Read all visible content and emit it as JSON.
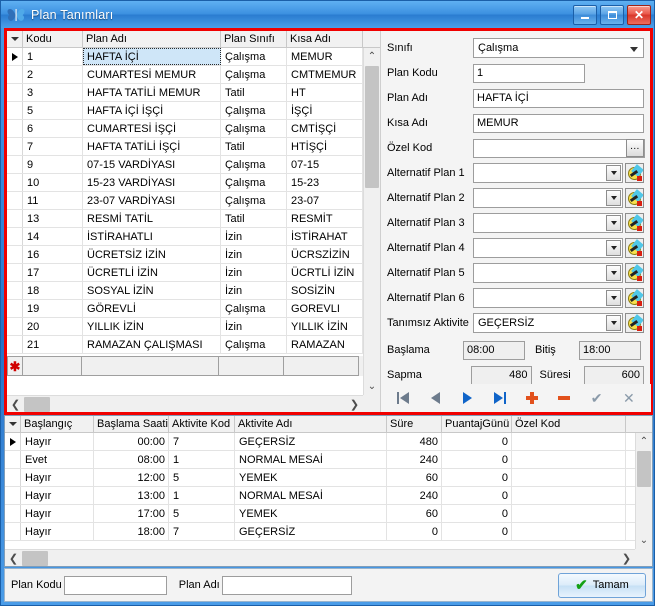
{
  "window": {
    "title": "Plan Tanımları",
    "icon": "butterfly-icon",
    "minimize_label": "_",
    "maximize_label": "□",
    "close_label": "✕",
    "accent_border": "#f00000",
    "titlebar_color": "#3c90e0"
  },
  "plans_grid": {
    "columns": [
      "Kodu",
      "Plan Adı",
      "Plan Sınıfı",
      "Kısa Adı"
    ],
    "selected_index": 0,
    "rows": [
      {
        "kodu": "1",
        "plan_adi": "HAFTA İÇİ",
        "plan_sinifi": "Çalışma",
        "kisa_adi": "MEMUR"
      },
      {
        "kodu": "2",
        "plan_adi": "CUMARTESİ MEMUR",
        "plan_sinifi": "Çalışma",
        "kisa_adi": "CMTMEMUR"
      },
      {
        "kodu": "3",
        "plan_adi": "HAFTA TATİLİ MEMUR",
        "plan_sinifi": "Tatil",
        "kisa_adi": "HT"
      },
      {
        "kodu": "5",
        "plan_adi": "HAFTA İÇİ İŞÇİ",
        "plan_sinifi": "Çalışma",
        "kisa_adi": "İŞÇİ"
      },
      {
        "kodu": "6",
        "plan_adi": "CUMARTESİ İŞÇİ",
        "plan_sinifi": "Çalışma",
        "kisa_adi": "CMTİŞÇİ"
      },
      {
        "kodu": "7",
        "plan_adi": "HAFTA TATİLİ İŞÇİ",
        "plan_sinifi": "Tatil",
        "kisa_adi": "HTİŞÇİ"
      },
      {
        "kodu": "9",
        "plan_adi": "07-15 VARDİYASI",
        "plan_sinifi": "Çalışma",
        "kisa_adi": "07-15"
      },
      {
        "kodu": "10",
        "plan_adi": "15-23 VARDİYASI",
        "plan_sinifi": "Çalışma",
        "kisa_adi": "15-23"
      },
      {
        "kodu": "11",
        "plan_adi": "23-07 VARDİYASI",
        "plan_sinifi": "Çalışma",
        "kisa_adi": "23-07"
      },
      {
        "kodu": "13",
        "plan_adi": "RESMİ TATİL",
        "plan_sinifi": "Tatil",
        "kisa_adi": "RESMİT"
      },
      {
        "kodu": "14",
        "plan_adi": "İSTİRAHATLI",
        "plan_sinifi": "İzin",
        "kisa_adi": "İSTİRAHAT"
      },
      {
        "kodu": "16",
        "plan_adi": "ÜCRETSİZ İZİN",
        "plan_sinifi": "İzin",
        "kisa_adi": "ÜCRSZİZİN"
      },
      {
        "kodu": "17",
        "plan_adi": "ÜCRETLİ İZİN",
        "plan_sinifi": "İzin",
        "kisa_adi": "ÜCRTLİ İZİN"
      },
      {
        "kodu": "18",
        "plan_adi": "SOSYAL İZİN",
        "plan_sinifi": "İzin",
        "kisa_adi": "SOSİZİN"
      },
      {
        "kodu": "19",
        "plan_adi": "GÖREVLİ",
        "plan_sinifi": "Çalışma",
        "kisa_adi": "GOREVLI"
      },
      {
        "kodu": "20",
        "plan_adi": "YILLIK İZİN",
        "plan_sinifi": "İzin",
        "kisa_adi": "YILLIK İZİN"
      },
      {
        "kodu": "21",
        "plan_adi": "RAMAZAN ÇALIŞMASI",
        "plan_sinifi": "Çalışma",
        "kisa_adi": "RAMAZAN"
      }
    ],
    "new_row_marker": "✱"
  },
  "form": {
    "fields": [
      {
        "label": "Sınıfı",
        "value": "Çalışma",
        "type": "select"
      },
      {
        "label": "Plan Kodu",
        "value": "1",
        "type": "text-short"
      },
      {
        "label": "Plan Adı",
        "value": "HAFTA İÇİ",
        "type": "text"
      },
      {
        "label": "Kısa Adı",
        "value": "MEMUR",
        "type": "text"
      },
      {
        "label": "Özel Kod",
        "value": "",
        "type": "text-ellipsis",
        "button": "…"
      },
      {
        "label": "Alternatif Plan 1",
        "value": "",
        "type": "lookup"
      },
      {
        "label": "Alternatif Plan 2",
        "value": "",
        "type": "lookup"
      },
      {
        "label": "Alternatif Plan 3",
        "value": "",
        "type": "lookup"
      },
      {
        "label": "Alternatif Plan 4",
        "value": "",
        "type": "lookup"
      },
      {
        "label": "Alternatif Plan 5",
        "value": "",
        "type": "lookup"
      },
      {
        "label": "Alternatif Plan 6",
        "value": "",
        "type": "lookup"
      },
      {
        "label": "Tanımsız Aktivite",
        "value": "GEÇERSİZ",
        "type": "lookup"
      }
    ],
    "times": {
      "baslama_label": "Başlama",
      "baslama_value": "08:00",
      "bitis_label": "Bitiş",
      "bitis_value": "18:00",
      "sapma_label": "Sapma",
      "sapma_value": "480",
      "suresi_label": "Süresi",
      "suresi_value": "600"
    }
  },
  "navbar": {
    "first": "first-record",
    "prev": "previous-record",
    "next": "next-record",
    "last": "last-record",
    "add": "add-record",
    "delete": "delete-record",
    "post": "post-edit",
    "cancel": "cancel-edit"
  },
  "detail_grid": {
    "columns": [
      "Başlangıç",
      "Başlama Saati",
      "Aktivite Kod",
      "Aktivite Adı",
      "Süre",
      "PuantajGünü",
      "Özel Kod"
    ],
    "selected_index": 0,
    "rows": [
      {
        "baslangic": "Hayır",
        "baslama_saati": "00:00",
        "aktivite_kod": "7",
        "aktivite_adi": "GEÇERSİZ",
        "sure": "480",
        "puantaj_gunu": "0",
        "ozel_kod": ""
      },
      {
        "baslangic": "Evet",
        "baslama_saati": "08:00",
        "aktivite_kod": "1",
        "aktivite_adi": "NORMAL MESAİ",
        "sure": "240",
        "puantaj_gunu": "0",
        "ozel_kod": ""
      },
      {
        "baslangic": "Hayır",
        "baslama_saati": "12:00",
        "aktivite_kod": "5",
        "aktivite_adi": "YEMEK",
        "sure": "60",
        "puantaj_gunu": "0",
        "ozel_kod": ""
      },
      {
        "baslangic": "Hayır",
        "baslama_saati": "13:00",
        "aktivite_kod": "1",
        "aktivite_adi": "NORMAL MESAİ",
        "sure": "240",
        "puantaj_gunu": "0",
        "ozel_kod": ""
      },
      {
        "baslangic": "Hayır",
        "baslama_saati": "17:00",
        "aktivite_kod": "5",
        "aktivite_adi": "YEMEK",
        "sure": "60",
        "puantaj_gunu": "0",
        "ozel_kod": ""
      },
      {
        "baslangic": "Hayır",
        "baslama_saati": "18:00",
        "aktivite_kod": "7",
        "aktivite_adi": "GEÇERSİZ",
        "sure": "0",
        "puantaj_gunu": "0",
        "ozel_kod": ""
      }
    ]
  },
  "statusbar": {
    "plan_kodu_label": "Plan Kodu",
    "plan_kodu_value": "",
    "plan_adi_label": "Plan Adı",
    "plan_adi_value": "",
    "ok_label": "Tamam",
    "ok_check": "✔"
  }
}
